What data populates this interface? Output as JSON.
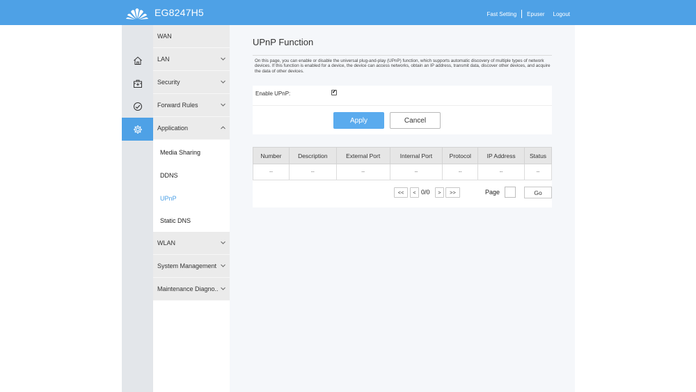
{
  "brand": {
    "title": "EG8247H5",
    "logo_icon": "huawei-logo"
  },
  "top_links": {
    "fast_setting": "Fast Setting",
    "user": "Epuser",
    "logout": "Logout"
  },
  "colors": {
    "accent": "#4ea1e6",
    "apply_button": "#5aabee",
    "icon_strip": "#e3e6ea",
    "menu_item": "#ebebeb"
  },
  "icon_strip": [
    "home-icon",
    "toolbox-icon",
    "speedometer-icon",
    "gear-icon"
  ],
  "menu": {
    "wan": "WAN",
    "lan": "LAN",
    "security": "Security",
    "forward_rules": "Forward Rules",
    "application": "Application",
    "application_sub": {
      "media_sharing": "Media Sharing",
      "ddns": "DDNS",
      "upnp": "UPnP",
      "static_dns": "Static DNS"
    },
    "wlan": "WLAN",
    "system_management": "System Management",
    "maintenance": "Maintenance Diagno.."
  },
  "page": {
    "title": "UPnP Function",
    "description": "On this page, you can enable or disable the universal plug-and-play (UPnP) function, which supports automatic discovery of multiple types of network devices. If this function is enabled for a device, the device can access networks, obtain an IP address, transmit data, discover other devices, and acquire the data of other devices.",
    "enable_label": "Enable UPnP:",
    "enable_checked": true,
    "checkmark": "✔",
    "apply": "Apply",
    "cancel": "Cancel"
  },
  "table": {
    "headers": [
      "Number",
      "Description",
      "External Port",
      "Internal Port",
      "Protocol",
      "IP Address",
      "Status"
    ],
    "rows": [
      [
        "--",
        "--",
        "--",
        "--",
        "--",
        "--",
        "--"
      ]
    ]
  },
  "pager": {
    "first": "<<",
    "prev": "<",
    "info": "0/0",
    "next": ">",
    "last": ">>",
    "page_label": "Page",
    "page_value": "",
    "go": "Go"
  }
}
